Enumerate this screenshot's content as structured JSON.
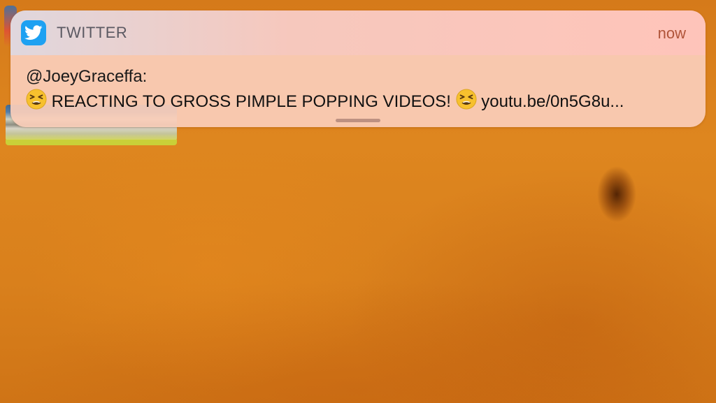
{
  "notification": {
    "app_name": "TWITTER",
    "time": "now",
    "app_icon": "twitter-bird-icon",
    "sender": "@JoeyGraceffa:",
    "message": {
      "emoji": "😫",
      "title": "REACTING TO GROSS PIMPLE POPPING VIDEOS!",
      "link": "youtu.be/0n5G8u..."
    }
  },
  "colors": {
    "twitter_blue": "#1da1f2",
    "background_orange": "#d9801c",
    "time_text": "#b0553a"
  }
}
